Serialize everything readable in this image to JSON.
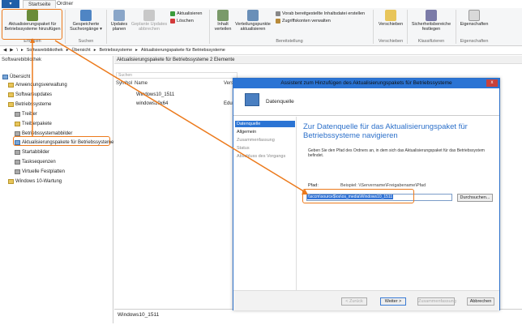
{
  "app_button": "▾",
  "tabs": [
    "Startseite",
    "Ordner"
  ],
  "ribbon": {
    "btn_add_pkg": "Aktualisierungspaket für Betriebssysteme hinzufügen",
    "group_create": "Erstellen",
    "btn_saved_searches": "Gespeicherte Suchvorgänge ▾",
    "group_search": "Suchen",
    "btn_updates_plan": "Updates planen",
    "btn_planned_updates_cancel": "Geplante Updates abbrechen",
    "btn_update": "Aktualisieren",
    "btn_delete": "Löschen",
    "btn_distribute_content": "Inhalt verteilen",
    "btn_update_dp": "Verteilungspunkte aktualisieren",
    "btn_prestaged": "Vorab bereitgestellte Inhaltsdatei erstellen",
    "btn_access_accounts": "Zugriffskonten verwalten",
    "group_deploy": "Bereitstellung",
    "btn_move": "Verschieben",
    "group_move": "Verschieben",
    "btn_security_scopes": "Sicherheitsbereiche festlegen",
    "group_classify": "Klassifizieren",
    "btn_properties": "Eigenschaften",
    "group_properties": "Eigenschaften"
  },
  "navbar": {
    "path": [
      "\\",
      "Softwarebibliothek",
      "Übersicht",
      "Betriebssysteme",
      "Aktualisierungspakete für Betriebssysteme"
    ]
  },
  "tree": {
    "header": "Softwarebibliothek",
    "items": [
      "Übersicht",
      "Anwendungsverwaltung",
      "Softwareupdates",
      "Betriebssysteme",
      "Treiber",
      "Treiberpakete",
      "Betriebssystemabbilder",
      "Aktualisierungspakete für Betriebssysteme",
      "Startabbilder",
      "Tasksequenzen",
      "Virtuelle Festplatten",
      "Windows 10-Wartung"
    ]
  },
  "main": {
    "header": "Aktualisierungspakete für Betriebssysteme 2 Elemente",
    "search_placeholder": "Suchen",
    "columns": [
      "Symbol",
      "Name",
      "Version"
    ],
    "rows": [
      {
        "name": "Windows10_1511"
      },
      {
        "name": "windows10x64",
        "extra": "Edu"
      }
    ],
    "detail_title": "Windows10_1511"
  },
  "dialog": {
    "title": "Assistent zum Hinzufügen des Aktualisierungspakets für Betriebssysteme",
    "close": "x",
    "banner": "Datenquelle",
    "steps": [
      "Datenquelle",
      "Allgemein",
      "Zusammenfassung",
      "Status",
      "Abschluss des Vorgangs"
    ],
    "heading": "Zur Datenquelle für das Aktualisierungspaket für Betriebssysteme navigieren",
    "desc": "Geben Sie den Pfad des Ordners an, in dem sich das Aktualisierungspaket für das Betriebssystem befindet.",
    "path_label": "Pfad:",
    "example": "Beispiel: \\\\Servername\\Freigabename\\Pfad",
    "path_value": "\\\\sccm\\source$\\os\\os_media\\Windows10_1511",
    "browse": "Durchsuchen...",
    "back": "< Zurück",
    "next": "Weiter >",
    "summary": "Zusammenfassung",
    "cancel": "Abbrechen"
  },
  "colors": {
    "accent": "#2b74d4",
    "highlight": "#ec7a1c"
  }
}
